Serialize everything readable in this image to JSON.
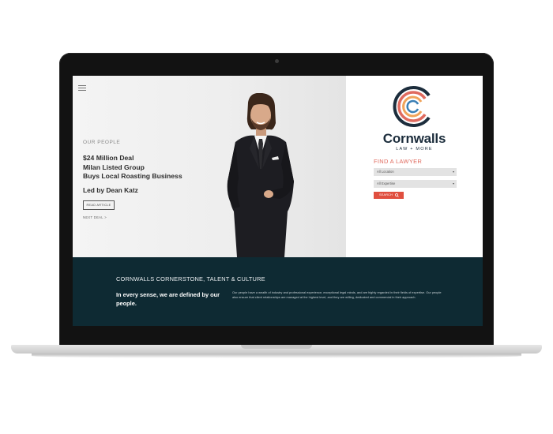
{
  "hero": {
    "eyebrow": "OUR PEOPLE",
    "title_lines": [
      "$24 Million Deal",
      "Milan Listed Group",
      "Buys Local Roasting Business"
    ],
    "byline": "Led by Dean Katz",
    "read_button": "READ ARTICLE",
    "next_link": "NEXT DEAL >"
  },
  "brand": {
    "name": "Cornwalls",
    "tagline": "LAW + MORE"
  },
  "finder": {
    "label": "FIND A LAWYER",
    "location_select": "All Location",
    "expertise_select": "All Expertise",
    "search_button": "SEARCH"
  },
  "culture": {
    "heading": "CORNWALLS CORNERSTONE, TALENT & CULTURE",
    "tagline": "In every sense, we are defined by our people.",
    "body": "Our people have a wealth of industry and professional experience, exceptional legal minds, and are highly regarded in their fields of expertise. Our people also ensure that client relationships are managed at the highest level, and they are willing, dedicated and commercial in their approach."
  },
  "colors": {
    "accent": "#e04f3f",
    "brand_navy": "#1c2d3c",
    "band_bg": "#0e2a33"
  }
}
